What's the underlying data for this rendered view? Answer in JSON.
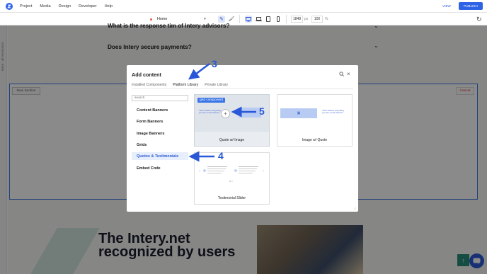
{
  "topbar": {
    "menu": [
      "Project",
      "Media",
      "Design",
      "Developer",
      "Help"
    ],
    "view_label": "VIEW",
    "publish_label": "PUBLISH"
  },
  "toolbar": {
    "page_name": "Home",
    "width_value": "1848",
    "width_unit": "px",
    "zoom_value": "100",
    "zoom_unit": "%"
  },
  "rail": {
    "text": "Base - all resolutions"
  },
  "canvas": {
    "faq1": "What is the response tim of Intery advisors?",
    "faq2": "Does Intery secure payments?",
    "new_section_label": "New Section",
    "cancel_label": "Cancel",
    "hero_title": "The Intery.net recognized by users"
  },
  "modal": {
    "title": "Add content",
    "tabs": [
      "Installed Components",
      "Platform Library",
      "Private Library"
    ],
    "active_tab": "Platform Library",
    "search_placeholder": "search",
    "categories": [
      "Content Banners",
      "Form Banners",
      "Image Banners",
      "Grids",
      "Quotes & Testimonials",
      "Embed Code"
    ],
    "active_category": "Quotes & Testimonials",
    "cards": [
      {
        "label": "Quote w/ Image",
        "tag": "grid component",
        "quote": "\"Don't believe everything you see on the internet.\""
      },
      {
        "label": "Image w/ Quote",
        "quote": "\"Don't believe everything you see on the internet.\""
      },
      {
        "label": "Testimonial Slider"
      }
    ]
  },
  "annotations": [
    "3",
    "4",
    "5"
  ],
  "colors": {
    "accent": "#2f63e6",
    "annotation": "#2857d8",
    "section_outline": "#3d7ae8",
    "cancel_text": "#dd3333"
  }
}
